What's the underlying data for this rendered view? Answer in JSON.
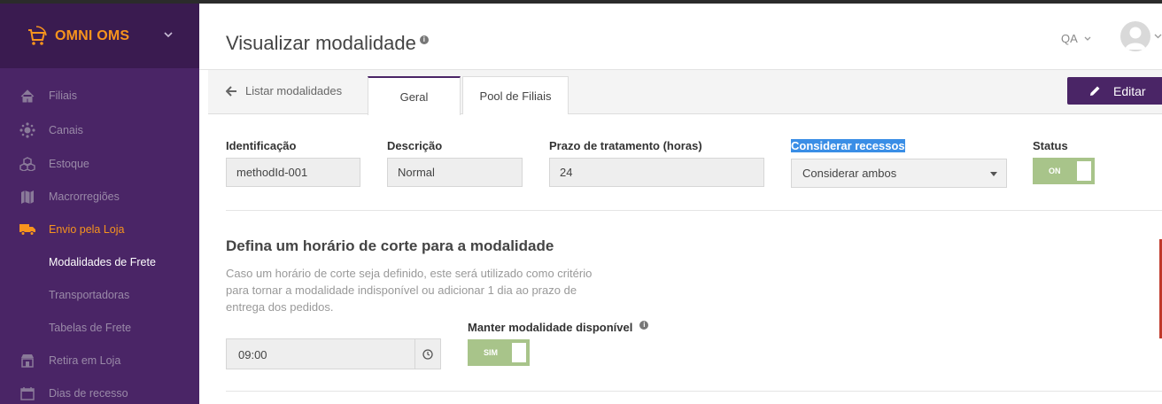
{
  "brand": {
    "name": "OMNI OMS"
  },
  "sidebar": {
    "items": [
      {
        "label": "Filiais",
        "icon": "home-icon"
      },
      {
        "label": "Canais",
        "icon": "channels-icon"
      },
      {
        "label": "Estoque",
        "icon": "cubes-icon"
      },
      {
        "label": "Macrorregiões",
        "icon": "map-icon"
      },
      {
        "label": "Envio pela Loja",
        "icon": "truck-icon",
        "active": true
      },
      {
        "label": "Retira em Loja",
        "icon": "store-icon"
      },
      {
        "label": "Dias de recesso",
        "icon": "calendar-icon"
      }
    ],
    "subitems": [
      {
        "label": "Modalidades de Frete",
        "current": true
      },
      {
        "label": "Transportadoras"
      },
      {
        "label": "Tabelas de Frete"
      }
    ]
  },
  "header": {
    "title": "Visualizar modalidade",
    "info": "i",
    "env": "QA"
  },
  "tabs": {
    "back": "Listar modalidades",
    "items": [
      "Geral",
      "Pool de Filiais"
    ],
    "edit": "Editar"
  },
  "form": {
    "identificacao": {
      "label": "Identificação",
      "value": "methodId-001"
    },
    "descricao": {
      "label": "Descrição",
      "value": "Normal"
    },
    "prazo": {
      "label": "Prazo de tratamento (horas)",
      "value": "24"
    },
    "recessos": {
      "label": "Considerar recessos",
      "value": "Considerar ambos"
    },
    "status": {
      "label": "Status",
      "value": "ON"
    }
  },
  "cutoff": {
    "title": "Defina um horário de corte para a modalidade",
    "description": "Caso um horário de corte seja definido, este será utilizado como critério para tornar a modalidade indisponível ou adicionar 1 dia ao prazo de entrega dos pedidos.",
    "time": "09:00",
    "keep_label": "Manter modalidade disponível",
    "keep_value": "SIM"
  },
  "colors": {
    "sidebar": "#4a2566",
    "accent": "#f7941d",
    "toggle_on": "#a8c48a"
  }
}
